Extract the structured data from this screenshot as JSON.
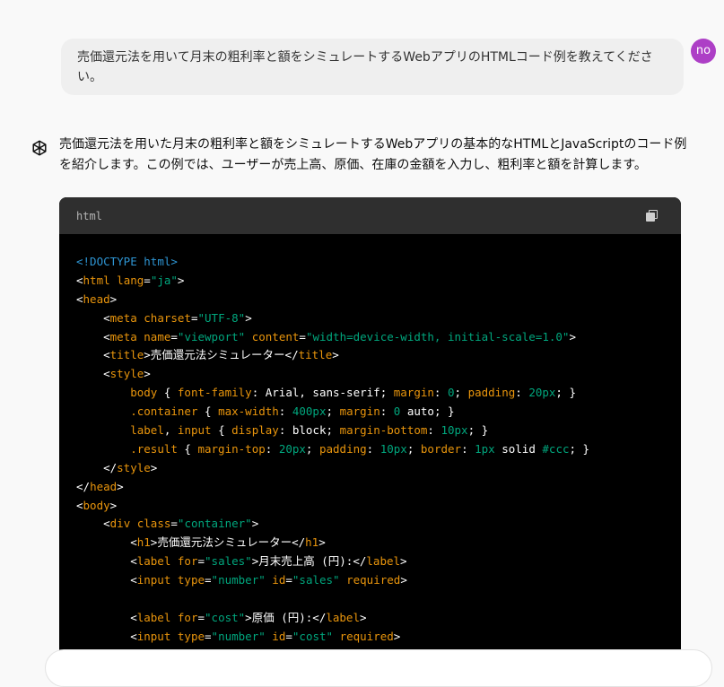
{
  "user_message": {
    "text": "売価還元法を用いて月末の粗利率と額をシミュレートするWebアプリのHTMLコード例を教えてください。",
    "avatar_initials": "no",
    "avatar_color": "#ad3fc6"
  },
  "assistant": {
    "icon": "chatgpt-logo-icon",
    "text": "売価還元法を用いた月末の粗利率と額をシミュレートするWebアプリの基本的なHTMLとJavaScriptのコード例を紹介します。この例では、ユーザーが売上高、原価、在庫の金額を入力し、粗利率と額を計算します。"
  },
  "code_block": {
    "language": "html",
    "copy_icon": "copy-icon",
    "lines": [
      [
        [
          "t-doc",
          "<!DOCTYPE "
        ],
        [
          "t-kw",
          "html"
        ],
        [
          "t-doc",
          ">"
        ]
      ],
      [
        [
          "t-plain",
          "<"
        ],
        [
          "t-tag",
          "html"
        ],
        [
          "t-plain",
          " "
        ],
        [
          "t-tag",
          "lang"
        ],
        [
          "t-plain",
          "="
        ],
        [
          "t-str",
          "\"ja\""
        ],
        [
          "t-plain",
          ">"
        ]
      ],
      [
        [
          "t-plain",
          "<"
        ],
        [
          "t-tag",
          "head"
        ],
        [
          "t-plain",
          ">"
        ]
      ],
      [
        [
          "t-plain",
          "    <"
        ],
        [
          "t-tag",
          "meta"
        ],
        [
          "t-plain",
          " "
        ],
        [
          "t-tag",
          "charset"
        ],
        [
          "t-plain",
          "="
        ],
        [
          "t-str",
          "\"UTF-8\""
        ],
        [
          "t-plain",
          ">"
        ]
      ],
      [
        [
          "t-plain",
          "    <"
        ],
        [
          "t-tag",
          "meta"
        ],
        [
          "t-plain",
          " "
        ],
        [
          "t-tag",
          "name"
        ],
        [
          "t-plain",
          "="
        ],
        [
          "t-str",
          "\"viewport\""
        ],
        [
          "t-plain",
          " "
        ],
        [
          "t-tag",
          "content"
        ],
        [
          "t-plain",
          "="
        ],
        [
          "t-str",
          "\"width=device-width, initial-scale=1.0\""
        ],
        [
          "t-plain",
          ">"
        ]
      ],
      [
        [
          "t-plain",
          "    <"
        ],
        [
          "t-tag",
          "title"
        ],
        [
          "t-plain",
          ">売価還元法シミュレーター</"
        ],
        [
          "t-tag",
          "title"
        ],
        [
          "t-plain",
          ">"
        ]
      ],
      [
        [
          "t-plain",
          "    <"
        ],
        [
          "t-tag",
          "style"
        ],
        [
          "t-plain",
          ">"
        ]
      ],
      [
        [
          "t-plain",
          "        "
        ],
        [
          "t-tag",
          "body"
        ],
        [
          "t-plain",
          " { "
        ],
        [
          "t-tag",
          "font-family"
        ],
        [
          "t-plain",
          ": Arial, sans-serif; "
        ],
        [
          "t-tag",
          "margin"
        ],
        [
          "t-plain",
          ": "
        ],
        [
          "t-str",
          "0"
        ],
        [
          "t-plain",
          "; "
        ],
        [
          "t-tag",
          "padding"
        ],
        [
          "t-plain",
          ": "
        ],
        [
          "t-str",
          "20px"
        ],
        [
          "t-plain",
          "; }"
        ]
      ],
      [
        [
          "t-plain",
          "        "
        ],
        [
          "t-tag",
          ".container"
        ],
        [
          "t-plain",
          " { "
        ],
        [
          "t-tag",
          "max-width"
        ],
        [
          "t-plain",
          ": "
        ],
        [
          "t-str",
          "400px"
        ],
        [
          "t-plain",
          "; "
        ],
        [
          "t-tag",
          "margin"
        ],
        [
          "t-plain",
          ": "
        ],
        [
          "t-str",
          "0"
        ],
        [
          "t-plain",
          " auto; }"
        ]
      ],
      [
        [
          "t-plain",
          "        "
        ],
        [
          "t-tag",
          "label"
        ],
        [
          "t-plain",
          ", "
        ],
        [
          "t-tag",
          "input"
        ],
        [
          "t-plain",
          " { "
        ],
        [
          "t-tag",
          "display"
        ],
        [
          "t-plain",
          ": block; "
        ],
        [
          "t-tag",
          "margin-bottom"
        ],
        [
          "t-plain",
          ": "
        ],
        [
          "t-str",
          "10px"
        ],
        [
          "t-plain",
          "; }"
        ]
      ],
      [
        [
          "t-plain",
          "        "
        ],
        [
          "t-tag",
          ".result"
        ],
        [
          "t-plain",
          " { "
        ],
        [
          "t-tag",
          "margin-top"
        ],
        [
          "t-plain",
          ": "
        ],
        [
          "t-str",
          "20px"
        ],
        [
          "t-plain",
          "; "
        ],
        [
          "t-tag",
          "padding"
        ],
        [
          "t-plain",
          ": "
        ],
        [
          "t-str",
          "10px"
        ],
        [
          "t-plain",
          "; "
        ],
        [
          "t-tag",
          "border"
        ],
        [
          "t-plain",
          ": "
        ],
        [
          "t-str",
          "1px"
        ],
        [
          "t-plain",
          " solid "
        ],
        [
          "t-str",
          "#ccc"
        ],
        [
          "t-plain",
          "; }"
        ]
      ],
      [
        [
          "t-plain",
          "    </"
        ],
        [
          "t-tag",
          "style"
        ],
        [
          "t-plain",
          ">"
        ]
      ],
      [
        [
          "t-plain",
          "</"
        ],
        [
          "t-tag",
          "head"
        ],
        [
          "t-plain",
          ">"
        ]
      ],
      [
        [
          "t-plain",
          "<"
        ],
        [
          "t-tag",
          "body"
        ],
        [
          "t-plain",
          ">"
        ]
      ],
      [
        [
          "t-plain",
          "    <"
        ],
        [
          "t-tag",
          "div"
        ],
        [
          "t-plain",
          " "
        ],
        [
          "t-tag",
          "class"
        ],
        [
          "t-plain",
          "="
        ],
        [
          "t-str",
          "\"container\""
        ],
        [
          "t-plain",
          ">"
        ]
      ],
      [
        [
          "t-plain",
          "        <"
        ],
        [
          "t-tag",
          "h1"
        ],
        [
          "t-plain",
          ">売価還元法シミュレーター</"
        ],
        [
          "t-tag",
          "h1"
        ],
        [
          "t-plain",
          ">"
        ]
      ],
      [
        [
          "t-plain",
          "        <"
        ],
        [
          "t-tag",
          "label"
        ],
        [
          "t-plain",
          " "
        ],
        [
          "t-tag",
          "for"
        ],
        [
          "t-plain",
          "="
        ],
        [
          "t-str",
          "\"sales\""
        ],
        [
          "t-plain",
          ">月末売上高 (円):</"
        ],
        [
          "t-tag",
          "label"
        ],
        [
          "t-plain",
          ">"
        ]
      ],
      [
        [
          "t-plain",
          "        <"
        ],
        [
          "t-tag",
          "input"
        ],
        [
          "t-plain",
          " "
        ],
        [
          "t-tag",
          "type"
        ],
        [
          "t-plain",
          "="
        ],
        [
          "t-str",
          "\"number\""
        ],
        [
          "t-plain",
          " "
        ],
        [
          "t-tag",
          "id"
        ],
        [
          "t-plain",
          "="
        ],
        [
          "t-str",
          "\"sales\""
        ],
        [
          "t-plain",
          " "
        ],
        [
          "t-tag",
          "required"
        ],
        [
          "t-plain",
          ">"
        ]
      ],
      [
        [
          "t-plain",
          ""
        ]
      ],
      [
        [
          "t-plain",
          "        <"
        ],
        [
          "t-tag",
          "label"
        ],
        [
          "t-plain",
          " "
        ],
        [
          "t-tag",
          "for"
        ],
        [
          "t-plain",
          "="
        ],
        [
          "t-str",
          "\"cost\""
        ],
        [
          "t-plain",
          ">原価 (円):</"
        ],
        [
          "t-tag",
          "label"
        ],
        [
          "t-plain",
          ">"
        ]
      ],
      [
        [
          "t-plain",
          "        <"
        ],
        [
          "t-tag",
          "input"
        ],
        [
          "t-plain",
          " "
        ],
        [
          "t-tag",
          "type"
        ],
        [
          "t-plain",
          "="
        ],
        [
          "t-str",
          "\"number\""
        ],
        [
          "t-plain",
          " "
        ],
        [
          "t-tag",
          "id"
        ],
        [
          "t-plain",
          "="
        ],
        [
          "t-str",
          "\"cost\""
        ],
        [
          "t-plain",
          " "
        ],
        [
          "t-tag",
          "required"
        ],
        [
          "t-plain",
          ">"
        ]
      ]
    ]
  }
}
